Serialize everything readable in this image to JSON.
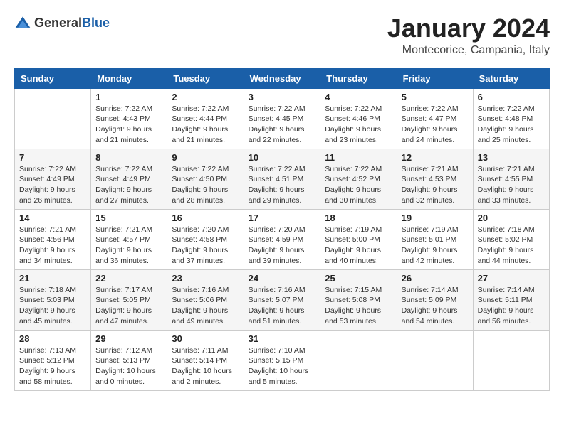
{
  "logo": {
    "general": "General",
    "blue": "Blue"
  },
  "header": {
    "month": "January 2024",
    "location": "Montecorice, Campania, Italy"
  },
  "weekdays": [
    "Sunday",
    "Monday",
    "Tuesday",
    "Wednesday",
    "Thursday",
    "Friday",
    "Saturday"
  ],
  "weeks": [
    [
      {
        "day": "",
        "info": ""
      },
      {
        "day": "1",
        "info": "Sunrise: 7:22 AM\nSunset: 4:43 PM\nDaylight: 9 hours\nand 21 minutes."
      },
      {
        "day": "2",
        "info": "Sunrise: 7:22 AM\nSunset: 4:44 PM\nDaylight: 9 hours\nand 21 minutes."
      },
      {
        "day": "3",
        "info": "Sunrise: 7:22 AM\nSunset: 4:45 PM\nDaylight: 9 hours\nand 22 minutes."
      },
      {
        "day": "4",
        "info": "Sunrise: 7:22 AM\nSunset: 4:46 PM\nDaylight: 9 hours\nand 23 minutes."
      },
      {
        "day": "5",
        "info": "Sunrise: 7:22 AM\nSunset: 4:47 PM\nDaylight: 9 hours\nand 24 minutes."
      },
      {
        "day": "6",
        "info": "Sunrise: 7:22 AM\nSunset: 4:48 PM\nDaylight: 9 hours\nand 25 minutes."
      }
    ],
    [
      {
        "day": "7",
        "info": "Sunrise: 7:22 AM\nSunset: 4:49 PM\nDaylight: 9 hours\nand 26 minutes."
      },
      {
        "day": "8",
        "info": "Sunrise: 7:22 AM\nSunset: 4:49 PM\nDaylight: 9 hours\nand 27 minutes."
      },
      {
        "day": "9",
        "info": "Sunrise: 7:22 AM\nSunset: 4:50 PM\nDaylight: 9 hours\nand 28 minutes."
      },
      {
        "day": "10",
        "info": "Sunrise: 7:22 AM\nSunset: 4:51 PM\nDaylight: 9 hours\nand 29 minutes."
      },
      {
        "day": "11",
        "info": "Sunrise: 7:22 AM\nSunset: 4:52 PM\nDaylight: 9 hours\nand 30 minutes."
      },
      {
        "day": "12",
        "info": "Sunrise: 7:21 AM\nSunset: 4:53 PM\nDaylight: 9 hours\nand 32 minutes."
      },
      {
        "day": "13",
        "info": "Sunrise: 7:21 AM\nSunset: 4:55 PM\nDaylight: 9 hours\nand 33 minutes."
      }
    ],
    [
      {
        "day": "14",
        "info": "Sunrise: 7:21 AM\nSunset: 4:56 PM\nDaylight: 9 hours\nand 34 minutes."
      },
      {
        "day": "15",
        "info": "Sunrise: 7:21 AM\nSunset: 4:57 PM\nDaylight: 9 hours\nand 36 minutes."
      },
      {
        "day": "16",
        "info": "Sunrise: 7:20 AM\nSunset: 4:58 PM\nDaylight: 9 hours\nand 37 minutes."
      },
      {
        "day": "17",
        "info": "Sunrise: 7:20 AM\nSunset: 4:59 PM\nDaylight: 9 hours\nand 39 minutes."
      },
      {
        "day": "18",
        "info": "Sunrise: 7:19 AM\nSunset: 5:00 PM\nDaylight: 9 hours\nand 40 minutes."
      },
      {
        "day": "19",
        "info": "Sunrise: 7:19 AM\nSunset: 5:01 PM\nDaylight: 9 hours\nand 42 minutes."
      },
      {
        "day": "20",
        "info": "Sunrise: 7:18 AM\nSunset: 5:02 PM\nDaylight: 9 hours\nand 44 minutes."
      }
    ],
    [
      {
        "day": "21",
        "info": "Sunrise: 7:18 AM\nSunset: 5:03 PM\nDaylight: 9 hours\nand 45 minutes."
      },
      {
        "day": "22",
        "info": "Sunrise: 7:17 AM\nSunset: 5:05 PM\nDaylight: 9 hours\nand 47 minutes."
      },
      {
        "day": "23",
        "info": "Sunrise: 7:16 AM\nSunset: 5:06 PM\nDaylight: 9 hours\nand 49 minutes."
      },
      {
        "day": "24",
        "info": "Sunrise: 7:16 AM\nSunset: 5:07 PM\nDaylight: 9 hours\nand 51 minutes."
      },
      {
        "day": "25",
        "info": "Sunrise: 7:15 AM\nSunset: 5:08 PM\nDaylight: 9 hours\nand 53 minutes."
      },
      {
        "day": "26",
        "info": "Sunrise: 7:14 AM\nSunset: 5:09 PM\nDaylight: 9 hours\nand 54 minutes."
      },
      {
        "day": "27",
        "info": "Sunrise: 7:14 AM\nSunset: 5:11 PM\nDaylight: 9 hours\nand 56 minutes."
      }
    ],
    [
      {
        "day": "28",
        "info": "Sunrise: 7:13 AM\nSunset: 5:12 PM\nDaylight: 9 hours\nand 58 minutes."
      },
      {
        "day": "29",
        "info": "Sunrise: 7:12 AM\nSunset: 5:13 PM\nDaylight: 10 hours\nand 0 minutes."
      },
      {
        "day": "30",
        "info": "Sunrise: 7:11 AM\nSunset: 5:14 PM\nDaylight: 10 hours\nand 2 minutes."
      },
      {
        "day": "31",
        "info": "Sunrise: 7:10 AM\nSunset: 5:15 PM\nDaylight: 10 hours\nand 5 minutes."
      },
      {
        "day": "",
        "info": ""
      },
      {
        "day": "",
        "info": ""
      },
      {
        "day": "",
        "info": ""
      }
    ]
  ]
}
